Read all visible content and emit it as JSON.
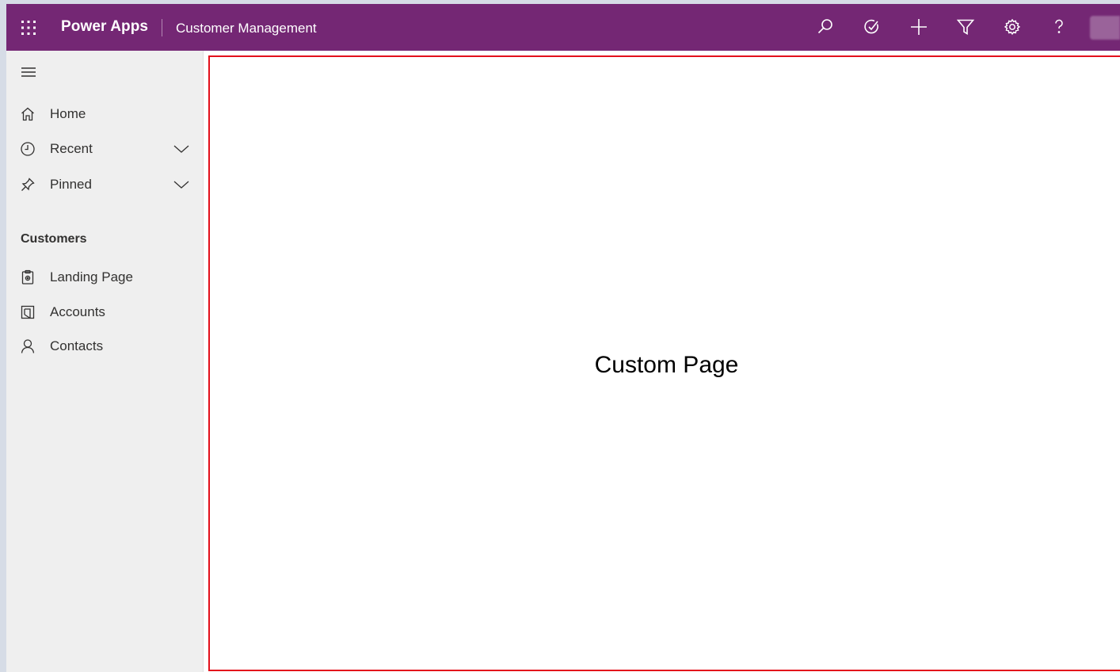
{
  "header": {
    "brand": "Power Apps",
    "app_name": "Customer Management",
    "background_color": "#742774",
    "icons": [
      "waffle-icon",
      "search-icon",
      "task-icon",
      "plus-icon",
      "filter-icon",
      "gear-icon",
      "help-icon",
      "avatar"
    ]
  },
  "sidebar": {
    "background_color": "#efefef",
    "top_items": [
      {
        "label": "Home",
        "icon": "home-icon"
      },
      {
        "label": "Recent",
        "icon": "clock-icon",
        "expandable": true
      },
      {
        "label": "Pinned",
        "icon": "pin-icon",
        "expandable": true
      }
    ],
    "section_title": "Customers",
    "section_items": [
      {
        "label": "Landing Page",
        "icon": "clipboard-gear-icon"
      },
      {
        "label": "Accounts",
        "icon": "accounts-icon"
      },
      {
        "label": "Contacts",
        "icon": "person-icon"
      }
    ]
  },
  "main": {
    "page_text": "Custom Page",
    "border_color": "#e3101b"
  }
}
